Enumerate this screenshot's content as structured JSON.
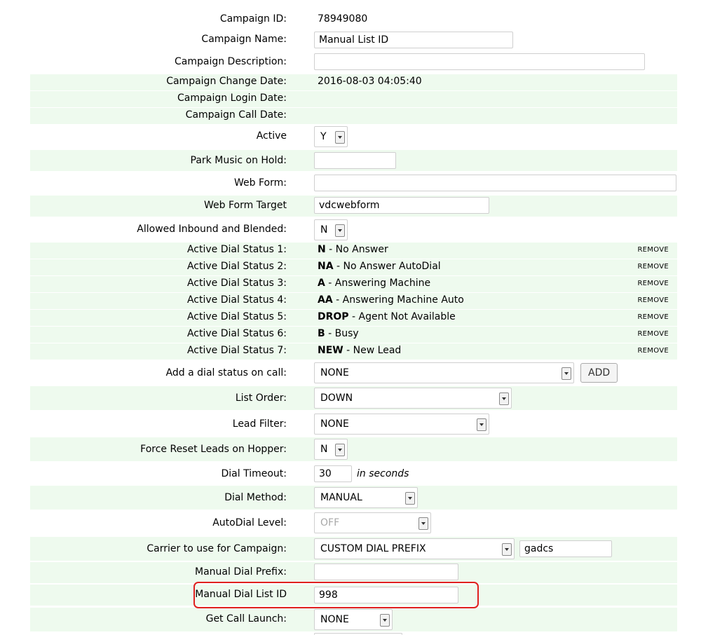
{
  "campaign_id": {
    "label": "Campaign ID:",
    "value": "78949080"
  },
  "campaign_name": {
    "label": "Campaign Name:",
    "value": "Manual List ID"
  },
  "campaign_description": {
    "label": "Campaign Description:",
    "value": ""
  },
  "change_date": {
    "label": "Campaign Change Date:",
    "value": "2016-08-03 04:05:40"
  },
  "login_date": {
    "label": "Campaign Login Date:",
    "value": ""
  },
  "call_date": {
    "label": "Campaign Call Date:",
    "value": ""
  },
  "active": {
    "label": "Active",
    "value": "Y"
  },
  "park_music": {
    "label": "Park Music on Hold:",
    "value": ""
  },
  "web_form": {
    "label": "Web Form:",
    "value": ""
  },
  "web_form_target": {
    "label": "Web Form Target",
    "value": "vdcwebform"
  },
  "allowed_inbound": {
    "label": "Allowed Inbound and Blended:",
    "value": "N"
  },
  "dial_statuses": [
    {
      "label": "Active Dial Status 1:",
      "code": "N",
      "desc": " - No Answer",
      "remove": "REMOVE"
    },
    {
      "label": "Active Dial Status 2:",
      "code": "NA",
      "desc": " - No Answer AutoDial",
      "remove": "REMOVE"
    },
    {
      "label": "Active Dial Status 3:",
      "code": "A",
      "desc": " - Answering Machine",
      "remove": "REMOVE"
    },
    {
      "label": "Active Dial Status 4:",
      "code": "AA",
      "desc": " - Answering Machine Auto",
      "remove": "REMOVE"
    },
    {
      "label": "Active Dial Status 5:",
      "code": "DROP",
      "desc": " - Agent Not Available",
      "remove": "REMOVE"
    },
    {
      "label": "Active Dial Status 6:",
      "code": "B",
      "desc": " - Busy",
      "remove": "REMOVE"
    },
    {
      "label": "Active Dial Status 7:",
      "code": "NEW",
      "desc": " - New Lead",
      "remove": "REMOVE"
    }
  ],
  "add_dial_status": {
    "label": "Add a dial status on call:",
    "value": "NONE",
    "button": "ADD"
  },
  "list_order": {
    "label": "List Order:",
    "value": "DOWN"
  },
  "lead_filter": {
    "label": "Lead Filter:",
    "value": "NONE"
  },
  "force_reset": {
    "label": "Force Reset Leads on Hopper:",
    "value": "N"
  },
  "dial_timeout": {
    "label": "Dial Timeout:",
    "value": "30",
    "unit": "in seconds"
  },
  "dial_method": {
    "label": "Dial Method:",
    "value": "MANUAL"
  },
  "autodial_level": {
    "label": "AutoDial Level:",
    "value": "OFF"
  },
  "carrier": {
    "label": "Carrier to use for Campaign:",
    "value": "CUSTOM DIAL PREFIX",
    "extra": "gadcs"
  },
  "manual_dial_prefix": {
    "label": "Manual Dial Prefix:",
    "value": ""
  },
  "manual_dial_list_id": {
    "label": "Manual Dial List ID",
    "value": "998"
  },
  "get_call_launch": {
    "label": "Get Call Launch:",
    "value": "NONE"
  },
  "highlight_color": "#e02020",
  "row_shade_color": "#eefaee"
}
